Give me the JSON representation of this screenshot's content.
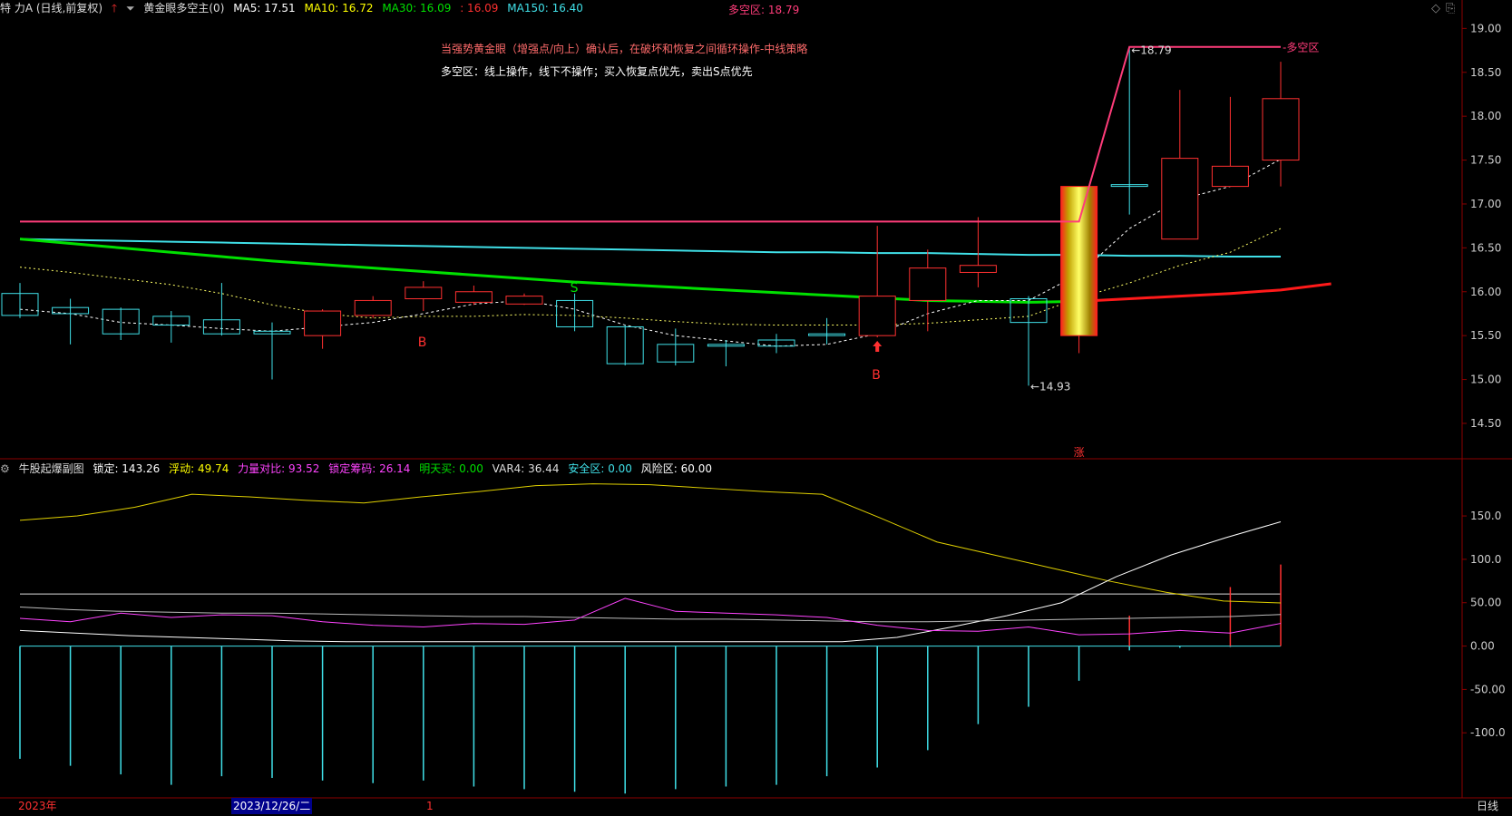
{
  "header": {
    "stock": "特 力A (日线,前复权)",
    "indicator": "黄金眼多空主(0)",
    "ma5": "MA5: 17.51",
    "ma10": "MA10: 16.72",
    "ma30": "MA30: 16.09",
    "ma30b": ": 16.09",
    "ma150": "MA150: 16.40",
    "dk": "多空区: 18.79"
  },
  "notes": {
    "line1": "当强势黄金眼（增强点/向上）确认后，在破坏和恢复之间循环操作-中线策略",
    "line2": "多空区：线上操作，线下不操作；买入恢复点优先，卖出S点优先"
  },
  "sub_header": {
    "name": "牛股起爆副图",
    "lock": "锁定: 143.26",
    "float": "浮动: 49.74",
    "power": "力量对比: 93.52",
    "chip": "锁定筹码: 26.14",
    "tomorrow": "明天买: 0.00",
    "var4": "VAR4: 36.44",
    "safe": "安全区: 0.00",
    "risk": "风险区: 60.00"
  },
  "bottom": {
    "year": "2023年",
    "date": "2023/12/26/二",
    "one": "1",
    "period": "日线"
  },
  "colors": {
    "up": "#ff3030",
    "down": "#40e0e8",
    "ma30": "#00e000",
    "ma150": "#40e0e8",
    "dkline": "#ff3c7a",
    "grid_red": "#8b0000"
  },
  "chart_data": [
    {
      "type": "candlestick",
      "name": "main",
      "ylim": [
        14.2,
        19.2
      ],
      "yticks": [
        "19.00",
        "18.50",
        "18.00",
        "17.50",
        "17.00",
        "16.50",
        "16.00",
        "15.50",
        "15.00",
        "14.50"
      ],
      "candles": [
        {
          "o": 15.98,
          "c": 15.73,
          "h": 16.1,
          "l": 15.7
        },
        {
          "o": 15.82,
          "c": 15.75,
          "h": 15.92,
          "l": 15.4
        },
        {
          "o": 15.8,
          "c": 15.52,
          "h": 15.82,
          "l": 15.45
        },
        {
          "o": 15.72,
          "c": 15.62,
          "h": 15.78,
          "l": 15.42
        },
        {
          "o": 15.68,
          "c": 15.52,
          "h": 16.1,
          "l": 15.5
        },
        {
          "o": 15.55,
          "c": 15.52,
          "h": 15.65,
          "l": 15.0
        },
        {
          "o": 15.5,
          "c": 15.78,
          "h": 15.8,
          "l": 15.35
        },
        {
          "o": 15.73,
          "c": 15.9,
          "h": 15.95,
          "l": 15.7
        },
        {
          "o": 15.92,
          "c": 16.05,
          "h": 16.12,
          "l": 15.78
        },
        {
          "o": 15.88,
          "c": 16.0,
          "h": 16.07,
          "l": 15.85
        },
        {
          "o": 15.86,
          "c": 15.95,
          "h": 15.98,
          "l": 15.85
        },
        {
          "o": 15.9,
          "c": 15.6,
          "h": 15.98,
          "l": 15.55
        },
        {
          "o": 15.6,
          "c": 15.18,
          "h": 15.62,
          "l": 15.16
        },
        {
          "o": 15.4,
          "c": 15.2,
          "h": 15.58,
          "l": 15.16
        },
        {
          "o": 15.4,
          "c": 15.38,
          "h": 15.45,
          "l": 15.15
        },
        {
          "o": 15.45,
          "c": 15.38,
          "h": 15.52,
          "l": 15.3
        },
        {
          "o": 15.52,
          "c": 15.5,
          "h": 15.7,
          "l": 15.4
        },
        {
          "o": 15.5,
          "c": 15.95,
          "h": 16.75,
          "l": 15.48
        },
        {
          "o": 15.9,
          "c": 16.27,
          "h": 16.48,
          "l": 15.55
        },
        {
          "o": 16.22,
          "c": 16.3,
          "h": 16.85,
          "l": 16.05
        },
        {
          "o": 15.92,
          "c": 15.65,
          "h": 15.95,
          "l": 14.93
        },
        {
          "o": 15.5,
          "c": 17.2,
          "h": 17.2,
          "l": 15.3
        },
        {
          "o": 17.22,
          "c": 17.2,
          "h": 18.79,
          "l": 16.88
        },
        {
          "o": 16.6,
          "c": 17.52,
          "h": 18.3,
          "l": 16.6
        },
        {
          "o": 17.2,
          "c": 17.43,
          "h": 18.22,
          "l": 17.2
        },
        {
          "o": 17.5,
          "c": 18.2,
          "h": 18.62,
          "l": 17.2
        }
      ],
      "ma150": [
        16.6,
        16.59,
        16.58,
        16.57,
        16.56,
        16.55,
        16.54,
        16.53,
        16.52,
        16.51,
        16.5,
        16.49,
        16.48,
        16.47,
        16.46,
        16.45,
        16.45,
        16.44,
        16.44,
        16.43,
        16.42,
        16.42,
        16.41,
        16.41,
        16.4,
        16.4
      ],
      "ma30_green": [
        16.6,
        16.55,
        16.5,
        16.45,
        16.4,
        16.35,
        16.31,
        16.27,
        16.23,
        16.19,
        16.15,
        16.11,
        16.08,
        16.05,
        16.02,
        15.99,
        15.96,
        15.93,
        15.9,
        15.89,
        15.88,
        15.89
      ],
      "ma30_red": [
        15.89,
        15.92,
        15.95,
        15.98,
        16.02,
        16.09
      ],
      "ma5": [
        15.8,
        15.75,
        15.65,
        15.62,
        15.58,
        15.55,
        15.6,
        15.65,
        15.75,
        15.86,
        15.9,
        15.8,
        15.62,
        15.5,
        15.44,
        15.38,
        15.4,
        15.52,
        15.75,
        15.9,
        15.9,
        16.2,
        16.72,
        17.05,
        17.2,
        17.51
      ],
      "ma10": [
        16.28,
        16.22,
        16.15,
        16.08,
        15.98,
        15.85,
        15.75,
        15.7,
        15.72,
        15.72,
        15.74,
        15.73,
        15.7,
        15.66,
        15.63,
        15.62,
        15.62,
        15.62,
        15.64,
        15.68,
        15.72,
        15.93,
        16.1,
        16.3,
        16.45,
        16.72
      ],
      "dk_line": [
        16.8,
        16.8,
        16.8,
        16.8,
        16.8,
        16.8,
        16.8,
        16.8,
        16.8,
        16.8,
        16.8,
        16.8,
        16.8,
        16.8,
        16.8,
        16.8,
        16.8,
        16.8,
        16.8,
        16.8,
        16.8,
        16.8,
        18.79,
        18.79,
        18.79,
        18.79
      ],
      "labels": {
        "low": "←14.93",
        "high": "←18.79",
        "dk": "-多空区",
        "b1": "B",
        "b2": "B",
        "s": "S",
        "zhang": "涨"
      }
    },
    {
      "type": "line",
      "name": "sub",
      "ylim": [
        -175,
        195
      ],
      "yticks": [
        "150.0",
        "100.0",
        "50.00",
        "0.00",
        "-50.00",
        "-100.0"
      ],
      "lock": [
        145,
        150,
        160,
        175,
        172,
        168,
        165,
        172,
        178,
        185,
        187,
        186,
        182,
        178,
        175,
        148,
        120,
        105,
        90,
        75,
        62,
        52,
        49.74
      ],
      "white_rise": [
        18,
        15,
        12,
        10,
        8,
        6,
        5,
        5,
        5,
        5,
        5,
        5,
        5,
        5,
        5,
        5,
        10,
        22,
        35,
        50,
        80,
        105,
        125,
        143.26
      ],
      "purple": [
        32,
        28,
        38,
        33,
        36,
        35,
        28,
        24,
        22,
        26,
        25,
        30,
        55,
        40,
        38,
        36,
        33,
        24,
        18,
        17,
        22,
        13,
        14,
        18,
        15,
        26.14
      ],
      "gray_rise": [
        45,
        42,
        40,
        39,
        38,
        38,
        37,
        36,
        35,
        34,
        34,
        33,
        32,
        31,
        31,
        30,
        29,
        28,
        28,
        29,
        30,
        31,
        32,
        33,
        34,
        36.44
      ],
      "white_hline": 60.0,
      "bars": [
        -130,
        -138,
        -148,
        -160,
        -150,
        -152,
        -155,
        -158,
        -155,
        -162,
        -165,
        -168,
        -170,
        -165,
        -162,
        -160,
        -150,
        -140,
        -120,
        -90,
        -70,
        -40,
        -5,
        -2,
        -1,
        0
      ],
      "red_bars": {
        "22": 35,
        "24": 68,
        "25": 94
      }
    }
  ]
}
